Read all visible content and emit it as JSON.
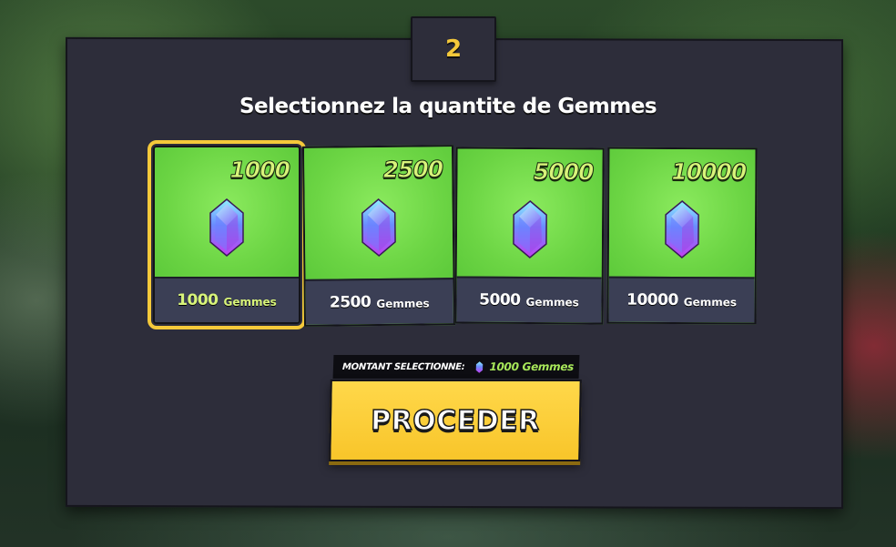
{
  "step": {
    "number": "2"
  },
  "title": "Selectionnez la quantite de Gemmes",
  "packages": [
    {
      "amount": "1000",
      "footer_amount": "1000",
      "unit": "Gemmes",
      "selected": true
    },
    {
      "amount": "2500",
      "footer_amount": "2500",
      "unit": "Gemmes",
      "selected": false
    },
    {
      "amount": "5000",
      "footer_amount": "5000",
      "unit": "Gemmes",
      "selected": false
    },
    {
      "amount": "10000",
      "footer_amount": "10000",
      "unit": "Gemmes",
      "selected": false
    }
  ],
  "selection": {
    "label": "MONTANT SELECTIONNE:",
    "value": "1000 Gemmes"
  },
  "proceed_button": {
    "label": "PROCEDER"
  },
  "icons": {
    "gem": "gem-icon"
  },
  "colors": {
    "panel": "#2d2d3a",
    "card_green": "#72d84a",
    "accent_yellow": "#f5c93a",
    "footer": "#3b3f55",
    "gem_top": "#7ae6ff",
    "gem_bottom": "#b64cf0"
  }
}
